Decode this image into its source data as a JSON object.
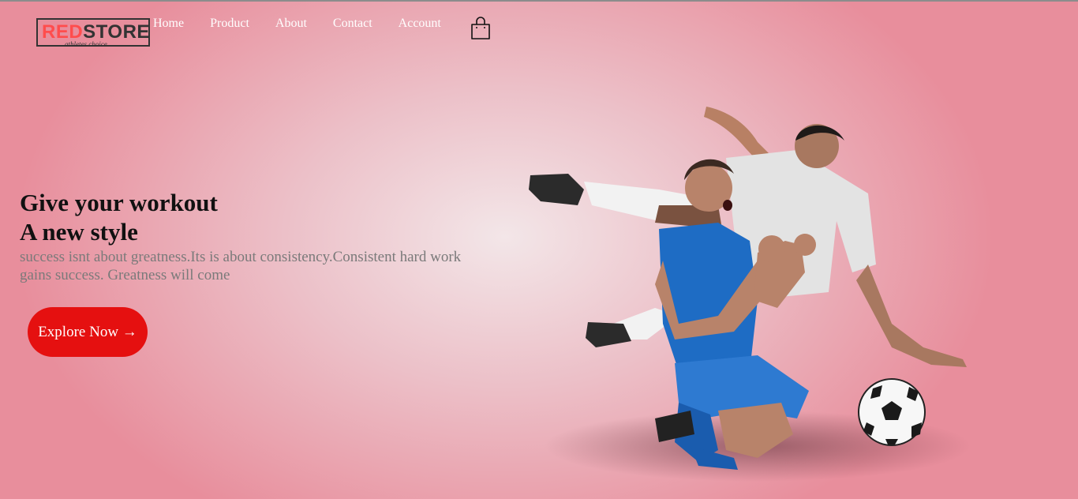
{
  "brand": {
    "name_part1": "RED",
    "name_part2": "STORE",
    "tagline": "athletes choice"
  },
  "nav": {
    "items": [
      {
        "label": "Home"
      },
      {
        "label": "Product"
      },
      {
        "label": "About"
      },
      {
        "label": "Contact"
      },
      {
        "label": "Account"
      }
    ],
    "cart_icon": "shopping-bag-icon"
  },
  "hero": {
    "headline_line1": "Give your workout",
    "headline_line2": "A new style",
    "description": "success isnt about greatness.Its is about consistency.Consistent hard work gains success. Greatness will come",
    "cta_label": "Explore Now →",
    "image": "soccer-players-image"
  },
  "colors": {
    "accent": "#e51010",
    "logo_red": "#ff4d4d",
    "background": "#e88e9c"
  }
}
